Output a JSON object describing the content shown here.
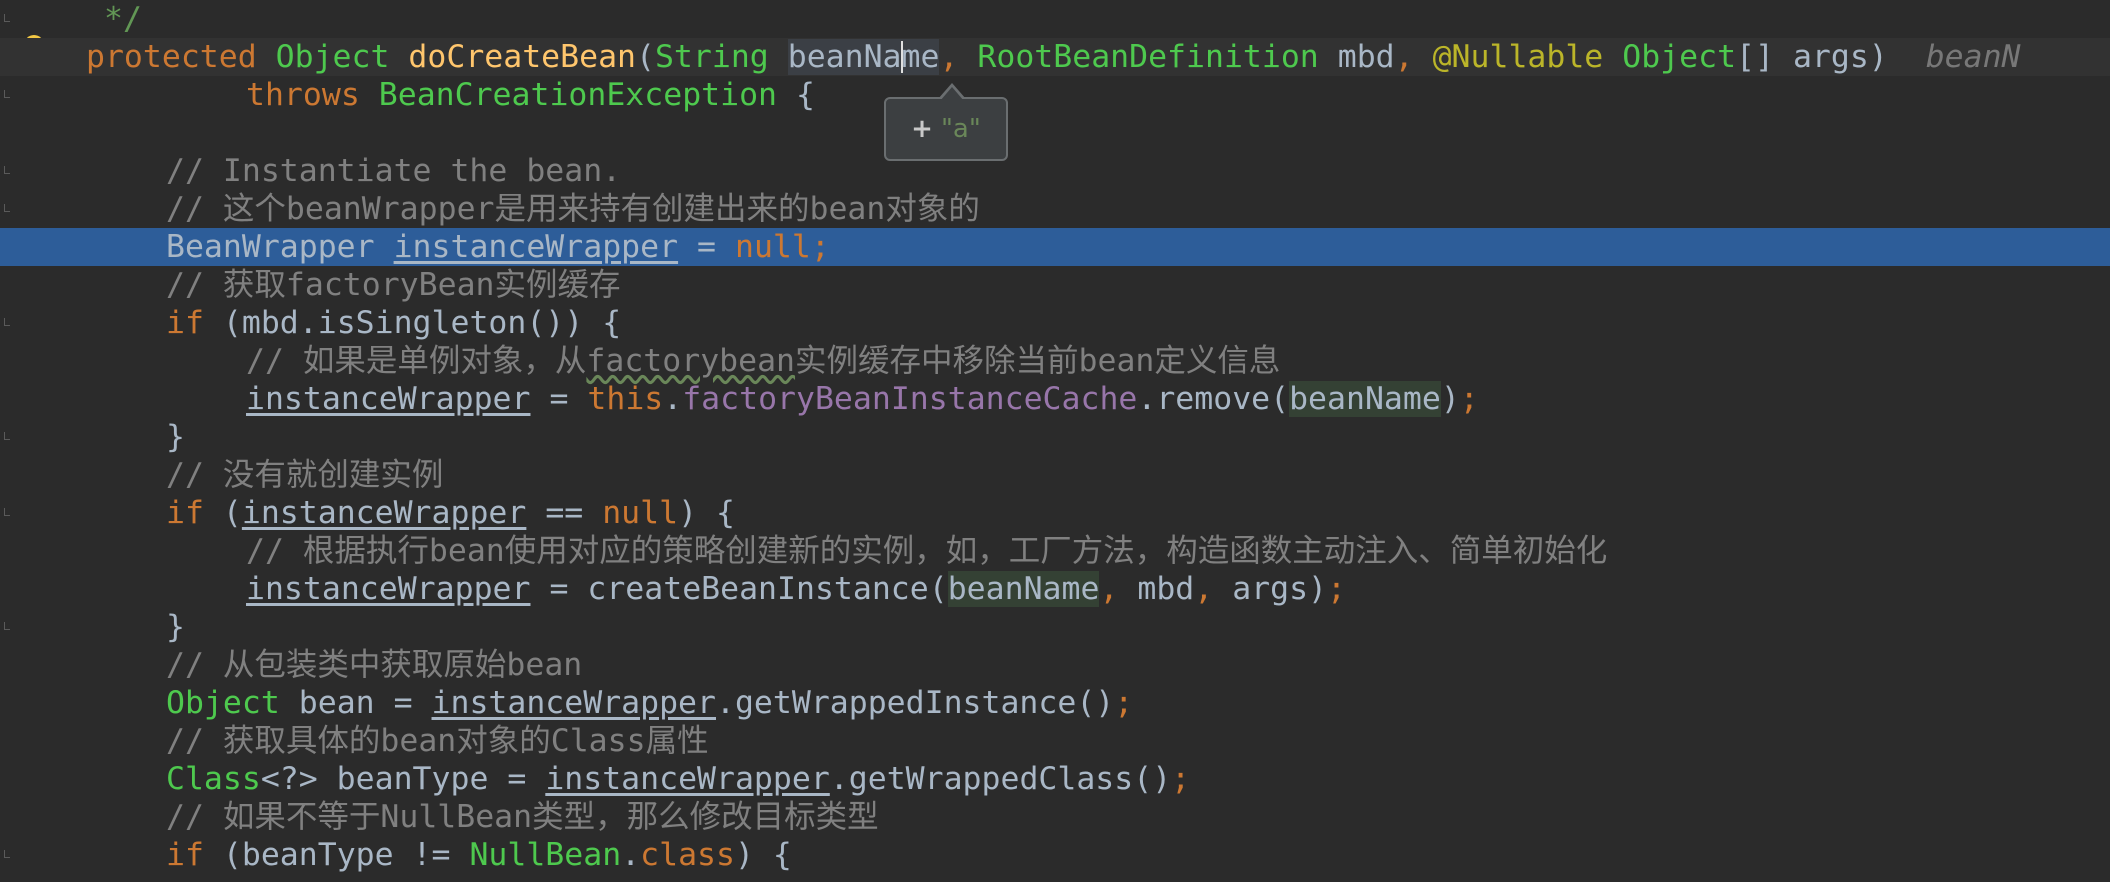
{
  "editor": {
    "tooltip": {
      "plus": "+",
      "value": "\"a\""
    },
    "lines": {
      "l0": {
        "doc_end": "*/"
      },
      "l1": {
        "kw": "protected",
        "t1": "Object",
        "fn": "doCreateBean",
        "p1": "(",
        "t2": "String",
        "name_a": "beanNa",
        "name_b": "me",
        "c1": ",",
        "t3": "RootBeanDefinition",
        "mbd": "mbd",
        "c2": ",",
        "ann": "@Nullable",
        "t4": "Object",
        "args": "[] args)",
        "hint": "beanN"
      },
      "l2": {
        "kw": "throws",
        "ty": "BeanCreationException",
        "rest": " {"
      },
      "l4": {
        "cm": "// Instantiate the bean."
      },
      "l5": {
        "cm": "// 这个beanWrapper是用来持有创建出来的bean对象的"
      },
      "l6": {
        "t": "BeanWrapper",
        "var": "instanceWrapper",
        "eq": " = ",
        "kw": "null",
        "semi": ";"
      },
      "l7": {
        "cm": "// 获取factoryBean实例缓存"
      },
      "l8": {
        "kw": "if",
        "rest": " (mbd.isSingleton()) {"
      },
      "l9": {
        "cm_a": "// 如果是单例对象，从",
        "cm_b": "factorybean",
        "cm_c": "实例缓存中移除当前bean定义信息"
      },
      "l10": {
        "var": "instanceWrapper",
        "eq": " = ",
        "kw": "this",
        "dot": ".",
        "fld": "factoryBeanInstanceCache",
        "call": ".remove(",
        "arg": "beanName",
        "close": ")",
        "semi": ";"
      },
      "l11": {
        "brace": "}"
      },
      "l12": {
        "cm": "// 没有就创建实例"
      },
      "l13": {
        "kw": "if",
        "p": " (",
        "var": "instanceWrapper",
        "op": " == ",
        "kw2": "null",
        "rest": ") {"
      },
      "l14": {
        "cm": "// 根据执行bean使用对应的策略创建新的实例，如，工厂方法，构造函数主动注入、简单初始化"
      },
      "l15": {
        "var": "instanceWrapper",
        "call": " = createBeanInstance(",
        "arg": "beanName",
        "c1": ",",
        "mbd": " mbd",
        "c2": ",",
        "args": " args)",
        "semi": ";"
      },
      "l16": {
        "brace": "}"
      },
      "l17": {
        "cm": "// 从包装类中获取原始bean"
      },
      "l18": {
        "t": "Object",
        "mid": " bean = ",
        "var": "instanceWrapper",
        "call": ".getWrappedInstance()",
        "semi": ";"
      },
      "l19": {
        "cm": "// 获取具体的bean对象的Class属性"
      },
      "l20": {
        "t": "Class",
        "mid": "<?> beanType = ",
        "var": "instanceWrapper",
        "call": ".getWrappedClass()",
        "semi": ";"
      },
      "l21": {
        "cm": "// 如果不等于NullBean类型，那么修改目标类型"
      },
      "l22": {
        "kw": "if",
        "mid": " (beanType != ",
        "t": "NullBean",
        "dot": ".",
        "kw2": "class",
        "rest": ") {"
      }
    }
  }
}
